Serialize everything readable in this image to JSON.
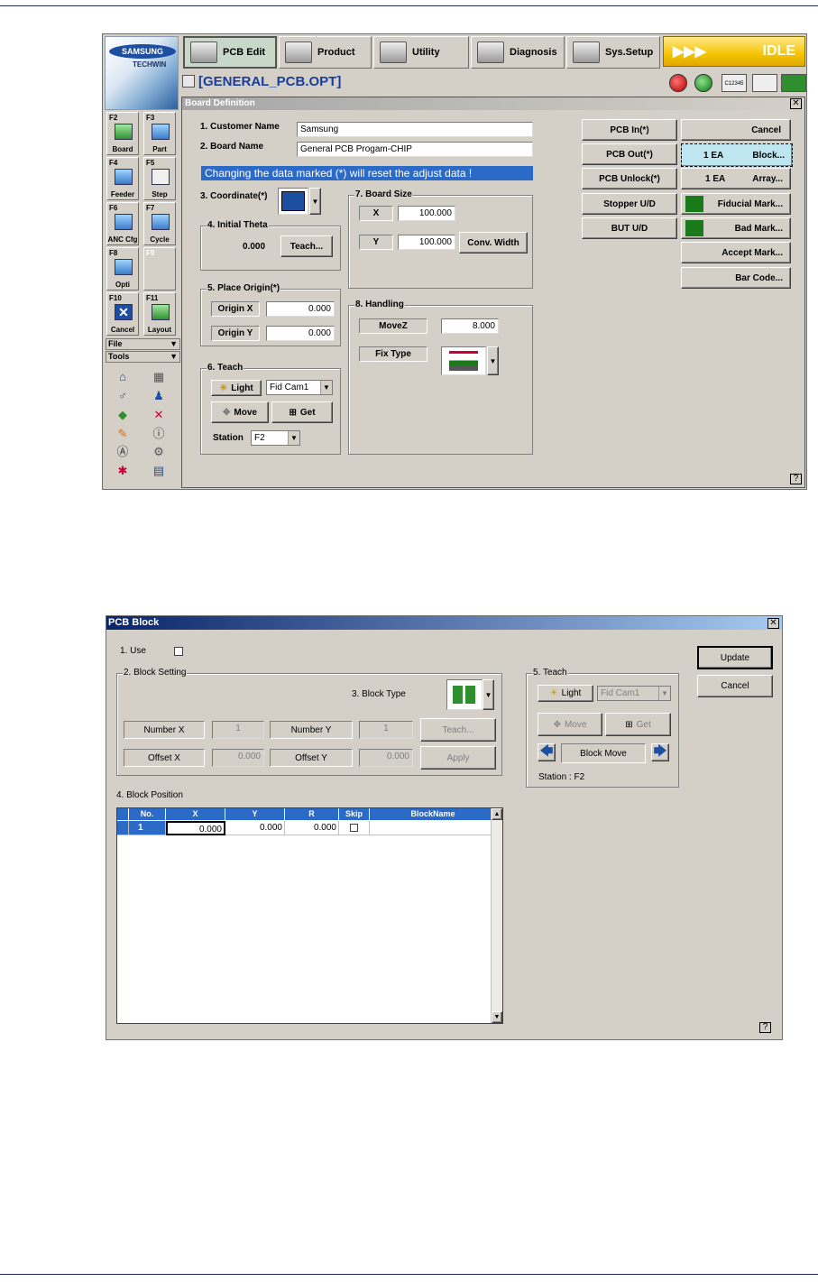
{
  "window1": {
    "logo_brand": "SAMSUNG",
    "logo_sub": "TECHWIN",
    "toolbar": [
      "PCB Edit",
      "Product",
      "Utility",
      "Diagnosis",
      "Sys.Setup"
    ],
    "status": "IDLE",
    "status_arrows": "▶▶▶",
    "filename": "[GENERAL_PCB.OPT]",
    "fkeys": [
      {
        "key": "F2",
        "label": "Board"
      },
      {
        "key": "F3",
        "label": "Part"
      },
      {
        "key": "F4",
        "label": "Feeder"
      },
      {
        "key": "F5",
        "label": "Step"
      },
      {
        "key": "F6",
        "label": "ANC Cfg"
      },
      {
        "key": "F7",
        "label": "Cycle"
      },
      {
        "key": "F8",
        "label": "Opti"
      },
      {
        "key": "F9",
        "label": ""
      },
      {
        "key": "F10",
        "label": "Cancel"
      },
      {
        "key": "F11",
        "label": "Layout"
      }
    ],
    "menus": [
      "File",
      "Tools"
    ],
    "panel_title": "Board Definition",
    "customer_name_label": "1. Customer Name",
    "customer_name_value": "Samsung",
    "board_name_label": "2. Board Name",
    "board_name_value": "General PCB Progam-CHIP",
    "warning": "Changing the data marked (*) will reset the adjust data !",
    "coordinate_label": "3. Coordinate(*)",
    "initial_theta": {
      "title": "4. Initial Theta",
      "value": "0.000",
      "teach": "Teach..."
    },
    "place_origin": {
      "title": "5. Place Origin(*)",
      "x_label": "Origin X",
      "x_value": "0.000",
      "y_label": "Origin Y",
      "y_value": "0.000"
    },
    "teach": {
      "title": "6. Teach",
      "light": "Light",
      "camera": "Fid Cam1",
      "move": "Move",
      "get": "Get",
      "station_label": "Station",
      "station_value": "F2"
    },
    "board_size": {
      "title": "7. Board Size",
      "x_label": "X",
      "x_value": "100.000",
      "y_label": "Y",
      "y_value": "100.000",
      "conv_width": "Conv. Width"
    },
    "handling": {
      "title": "8. Handling",
      "movez_label": "MoveZ",
      "movez_value": "8.000",
      "fix_type_label": "Fix Type"
    },
    "left_buttons": [
      "PCB In(*)",
      "PCB Out(*)",
      "PCB Unlock(*)",
      "Stopper U/D",
      "BUT U/D"
    ],
    "right_buttons": {
      "cancel": "Cancel",
      "block_count": "1 EA",
      "block": "Block...",
      "array_count": "1 EA",
      "array": "Array...",
      "fiducial": "Fiducial Mark...",
      "bad": "Bad Mark...",
      "accept": "Accept Mark...",
      "barcode": "Bar Code..."
    },
    "help": "?"
  },
  "window2": {
    "title": "PCB Block",
    "use_label": "1. Use",
    "block_setting": {
      "title": "2. Block Setting",
      "block_type": "3. Block Type",
      "number_x_label": "Number X",
      "number_x_value": "1",
      "number_y_label": "Number Y",
      "number_y_value": "1",
      "offset_x_label": "Offset  X",
      "offset_x_value": "0.000",
      "offset_y_label": "Offset  Y",
      "offset_y_value": "0.000",
      "teach": "Teach...",
      "apply": "Apply"
    },
    "teach": {
      "title": "5. Teach",
      "light": "Light",
      "camera": "Fid Cam1",
      "move": "Move",
      "get": "Get",
      "block_move": "Block Move",
      "station": "Station :  F2"
    },
    "update": "Update",
    "cancel": "Cancel",
    "block_position": {
      "title": "4. Block Position",
      "columns": [
        "No.",
        "X",
        "Y",
        "R",
        "Skip",
        "BlockName"
      ],
      "rows": [
        {
          "no": "1",
          "x": "0.000",
          "y": "0.000",
          "r": "0.000",
          "blockname": ""
        }
      ]
    },
    "help": "?"
  }
}
